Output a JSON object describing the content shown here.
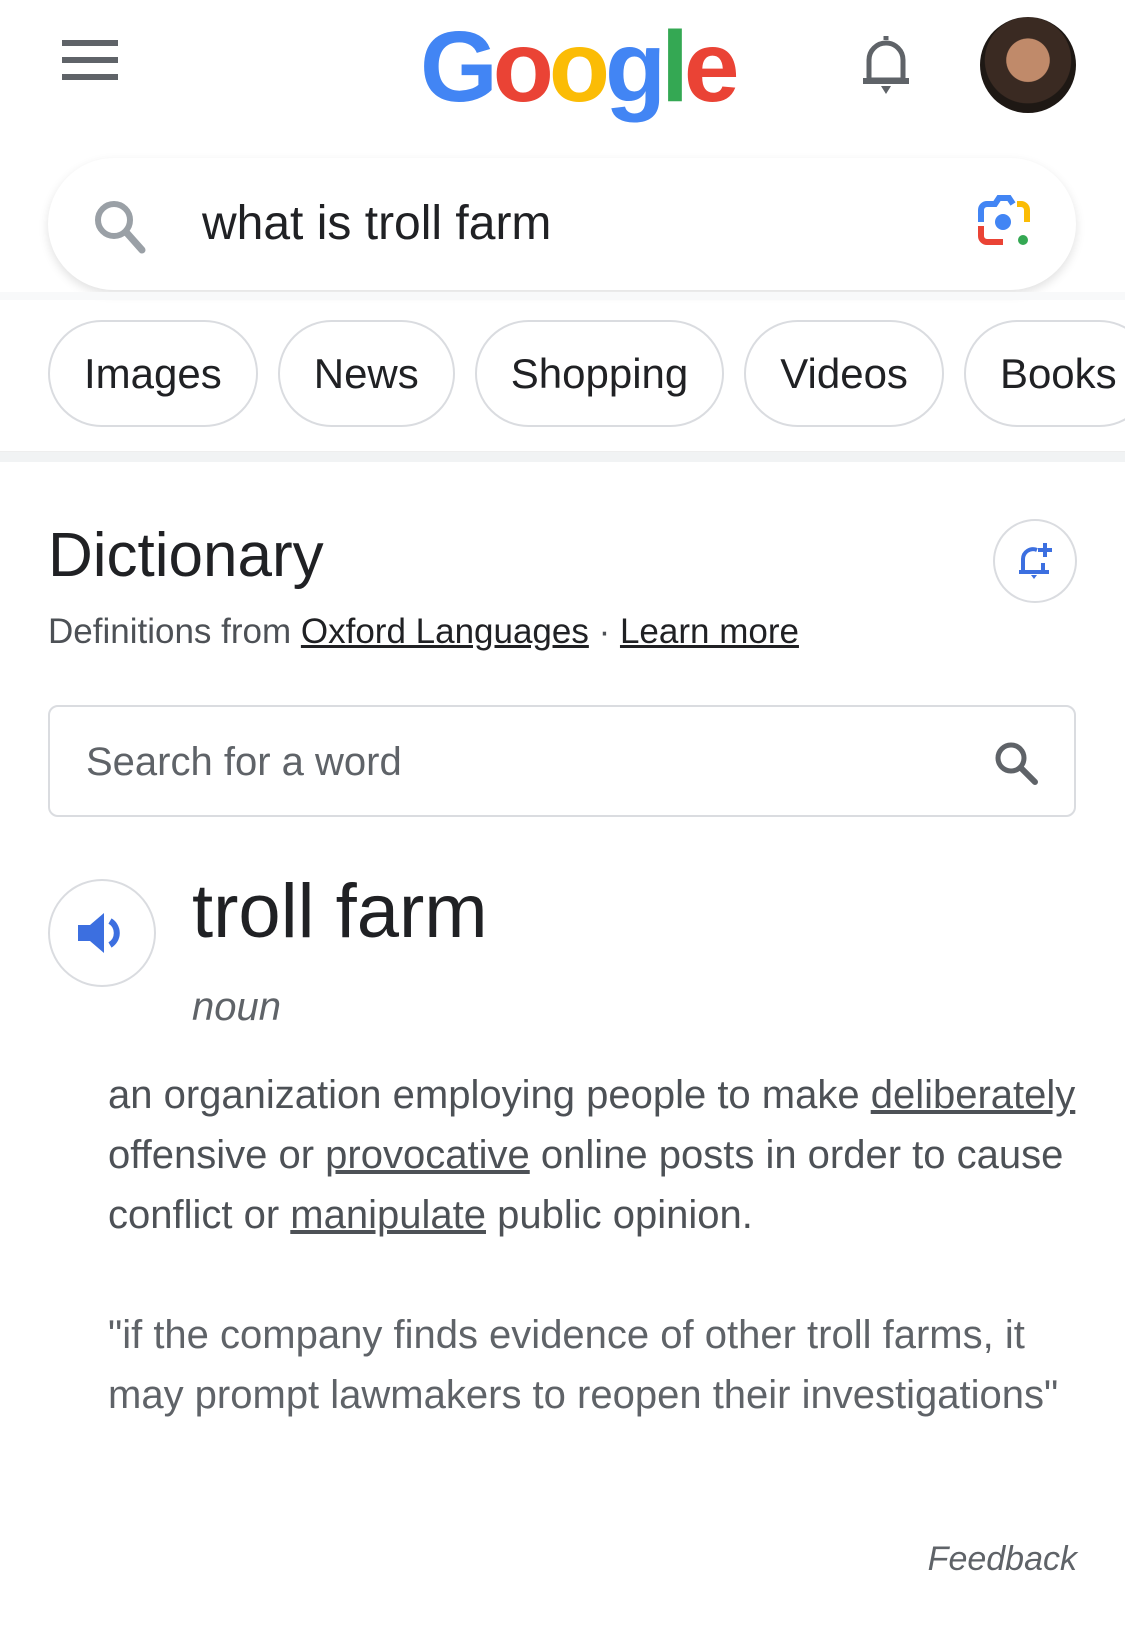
{
  "header": {
    "logo_letters": [
      {
        "ch": "G",
        "color": "#4285F4"
      },
      {
        "ch": "o",
        "color": "#EA4335"
      },
      {
        "ch": "o",
        "color": "#FBBC05"
      },
      {
        "ch": "g",
        "color": "#4285F4"
      },
      {
        "ch": "l",
        "color": "#34A853"
      },
      {
        "ch": "e",
        "color": "#EA4335"
      }
    ],
    "icons": [
      "menu-icon",
      "notifications-bell-icon",
      "account-avatar"
    ]
  },
  "search": {
    "query": "what is troll farm"
  },
  "chips": [
    "Images",
    "News",
    "Shopping",
    "Videos",
    "Books"
  ],
  "dictionary": {
    "title": "Dictionary",
    "source_prefix": "Definitions from ",
    "source_link": "Oxford Languages",
    "separator": " · ",
    "learn_more": "Learn more",
    "word_search_placeholder": "Search for a word",
    "headword": "troll farm",
    "part_of_speech": "noun",
    "definition": {
      "p1": "an organization employing people to make ",
      "l1": "deliberately",
      "p2": " offensive or ",
      "l2": "provocative",
      "p3": " online posts in order to cause conflict or ",
      "l3": "manipulate",
      "p4": " public opinion."
    },
    "example": "\"if the company finds evidence of other troll farms, it may prompt lawmakers to reopen their investigations\"",
    "feedback": "Feedback"
  },
  "colors": {
    "accent_blue": "#3C6FE0",
    "text_primary": "#202124",
    "text_secondary": "#4d5156"
  }
}
